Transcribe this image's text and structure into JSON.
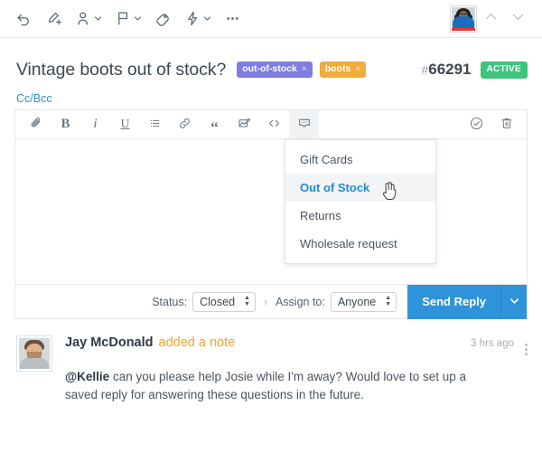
{
  "toolbar": {
    "items": [
      {
        "name": "undo-icon",
        "label": "Undo"
      },
      {
        "name": "edit-icon",
        "label": "Edit"
      },
      {
        "name": "assign-user-icon",
        "label": "Assign"
      },
      {
        "name": "flag-icon",
        "label": "Flag"
      },
      {
        "name": "tag-icon",
        "label": "Tag"
      },
      {
        "name": "automation-icon",
        "label": "Automation"
      },
      {
        "name": "more-icon",
        "label": "More"
      }
    ],
    "avatar_alt": "Agent avatar",
    "prev_label": "Previous",
    "next_label": "Next"
  },
  "ticket": {
    "title": "Vintage boots out of stock?",
    "tags": [
      {
        "label": "out-of-stock",
        "color": "#7e7ee0",
        "remove": "×"
      },
      {
        "label": "boots",
        "color": "#f0ad3c",
        "remove": "×"
      }
    ],
    "hash": "#",
    "number": "66291",
    "status_badge": "ACTIVE",
    "status_badge_color": "#3ec47d"
  },
  "composer": {
    "ccbcc_label": "Cc/Bcc",
    "toolbar_buttons": [
      {
        "name": "attachment-icon",
        "label": "Attach file",
        "active": false
      },
      {
        "name": "bold-icon",
        "label": "B",
        "active": false
      },
      {
        "name": "italic-icon",
        "label": "i",
        "active": false
      },
      {
        "name": "underline-icon",
        "label": "U",
        "active": false
      },
      {
        "name": "bulleted-list-icon",
        "label": "List",
        "active": false
      },
      {
        "name": "link-icon",
        "label": "Link",
        "active": false
      },
      {
        "name": "blockquote-icon",
        "label": "“",
        "active": false
      },
      {
        "name": "insert-image-icon",
        "label": "Image",
        "active": false
      },
      {
        "name": "code-icon",
        "label": "Code",
        "active": false
      },
      {
        "name": "saved-replies-icon",
        "label": "Saved replies",
        "active": true
      }
    ],
    "right_buttons": [
      {
        "name": "check-circle-icon",
        "label": "Confirm"
      },
      {
        "name": "trash-icon",
        "label": "Delete draft"
      }
    ],
    "body_value": "",
    "body_placeholder": "",
    "status_label": "Status:",
    "status_value": "Closed",
    "arrow_separator": "›",
    "assign_label": "Assign to:",
    "assign_value": "Anyone",
    "send_label": "Send Reply",
    "send_caret": "⌄"
  },
  "saved_replies_menu": {
    "items": [
      {
        "label": "Gift Cards",
        "selected": false
      },
      {
        "label": "Out of Stock",
        "selected": true
      },
      {
        "label": "Returns",
        "selected": false
      },
      {
        "label": "Wholesale request",
        "selected": false
      }
    ]
  },
  "note": {
    "author": "Jay McDonald",
    "action": "added a note",
    "action_color": "#f0a429",
    "time": "3 hrs ago",
    "mention": "@Kellie",
    "body": " can you please help Josie while I'm away? Would love to set up a saved reply for answering these questions in the future.",
    "avatar_alt": "Jay McDonald avatar"
  }
}
